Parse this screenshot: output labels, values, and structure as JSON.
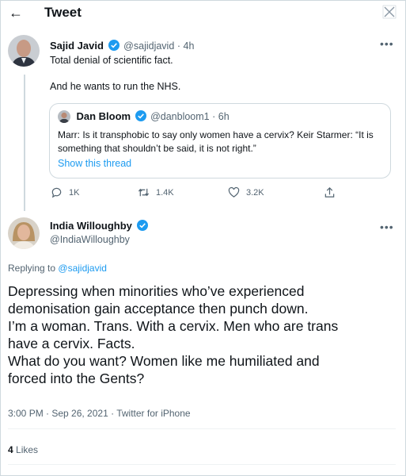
{
  "header": {
    "title": "Tweet",
    "back_icon": "arrow-left-icon",
    "close_icon": "close-icon"
  },
  "parent_tweet": {
    "name": "Sajid Javid",
    "handle": "@sajidjavid",
    "time": "4h",
    "text_lines": [
      "Total denial of scientific fact.",
      "And he wants to run the NHS."
    ],
    "quote": {
      "name": "Dan Bloom",
      "handle": "@danbloom1",
      "time": "6h",
      "text": "Marr: Is it transphobic to say only women have a cervix? Keir Starmer: “It is something that shouldn’t be said, it is not right.”",
      "link": "Show this thread"
    },
    "actions": {
      "replies": "1K",
      "retweets": "1.4K",
      "likes": "3.2K"
    }
  },
  "main_tweet": {
    "name": "India Willoughby",
    "handle": "@IndiaWilloughby",
    "replying_prefix": "Replying to",
    "replying_to": "@sajidjavid",
    "text_lines": [
      "Depressing when minorities who’ve experienced",
      "demonisation gain acceptance then punch down.",
      "I’m a woman. Trans. With a cervix. Men who are trans",
      "have a cervix. Facts.",
      "What do you want? Women like me humiliated and",
      "forced into the Gents?"
    ],
    "meta": "3:00 PM · Sep 26, 2021 · Twitter for iPhone",
    "likes_count": "4",
    "likes_label": "Likes"
  },
  "colors": {
    "accent": "#1d9bf0",
    "verified": "#1d9bf0",
    "muted": "#536471",
    "border": "#cfd9de"
  }
}
